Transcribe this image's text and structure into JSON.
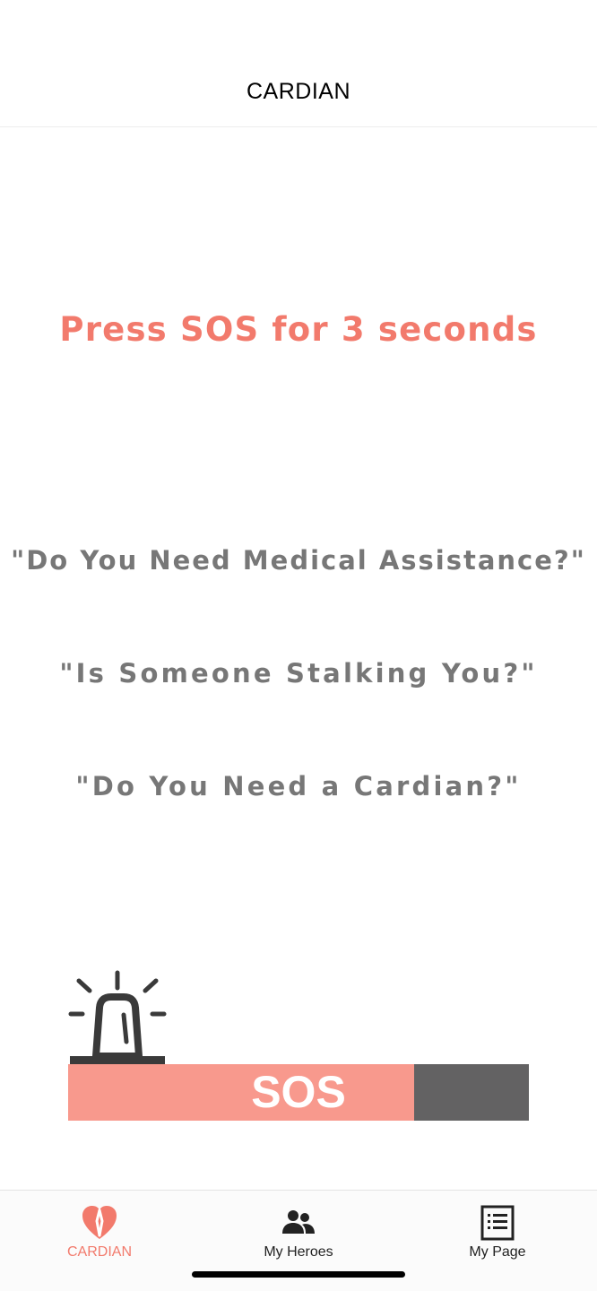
{
  "header": {
    "title": "CARDIAN"
  },
  "main": {
    "instruction": "Press SOS for 3 seconds",
    "prompts": [
      "\"Do You Need Medical Assistance?\"",
      "\"Is Someone Stalking You?\"",
      "\"Do You Need a Cardian?\""
    ]
  },
  "sos": {
    "label": "SOS",
    "progress": 0.75,
    "icon": "siren-icon"
  },
  "tabs": [
    {
      "label": "CARDIAN",
      "icon": "heart-icon",
      "active": true
    },
    {
      "label": "My Heroes",
      "icon": "people-icon",
      "active": false
    },
    {
      "label": "My Page",
      "icon": "list-icon",
      "active": false
    }
  ],
  "colors": {
    "accent": "#f27a6c",
    "sos_fill": "#f8998d",
    "sos_track": "#636263",
    "prompt_text": "#777777",
    "tab_inactive": "#222222"
  }
}
